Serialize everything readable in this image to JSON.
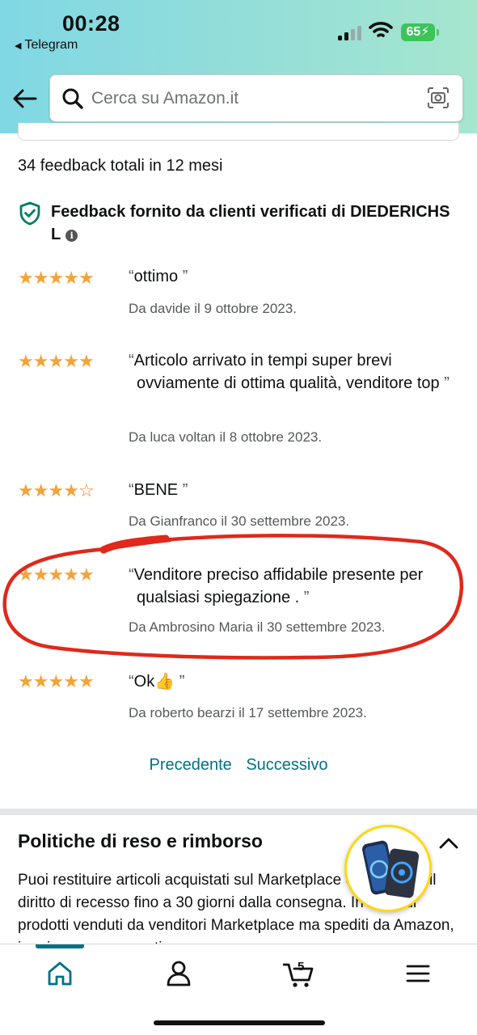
{
  "status_bar": {
    "time": "00:28",
    "back_app": "Telegram",
    "battery": "65"
  },
  "search": {
    "placeholder": "Cerca su Amazon.it"
  },
  "feedback": {
    "total_text": "34 feedback totali in 12 mesi",
    "verified_text": "Feedback fornito da clienti verificati di DIEDERICHS L",
    "info_glyph": "i",
    "reviews": [
      {
        "rating": 5,
        "text": "ottimo",
        "author": "Da davide il 9 ottobre 2023."
      },
      {
        "rating": 5,
        "text": "Articolo arrivato in tempi super brevi ovviamente di ottima qualità, venditore top",
        "author": "Da luca voltan il 8 ottobre 2023."
      },
      {
        "rating": 4,
        "text": "BENE",
        "author": "Da Gianfranco il 30 settembre 2023."
      },
      {
        "rating": 5,
        "text": "Venditore preciso affidabile presente per qualsiasi spiegazione .",
        "author": "Da Ambrosino Maria il 30 settembre 2023."
      },
      {
        "rating": 5,
        "text": "Ok👍",
        "author": "Da roberto bearzi il 17 settembre 2023."
      }
    ],
    "pager": {
      "prev": "Precedente",
      "next": "Successivo"
    }
  },
  "policy": {
    "title": "Politiche di reso e rimborso",
    "text": "Puoi restituire articoli acquistati sul Marketplace esercitando il diritto di recesso fino a 30 giorni dalla consegna. In caso di prodotti venduti da venditori Marketplace ma spediti da Amazon, i resi sono processati"
  },
  "bottom_nav": {
    "cart_count": "5",
    "items": [
      "home-icon",
      "account-icon",
      "cart-icon",
      "menu-icon"
    ]
  },
  "colors": {
    "accent": "#007185",
    "star": "#f3a33a",
    "annotation": "#e0281c",
    "battery": "#3bc45a"
  }
}
